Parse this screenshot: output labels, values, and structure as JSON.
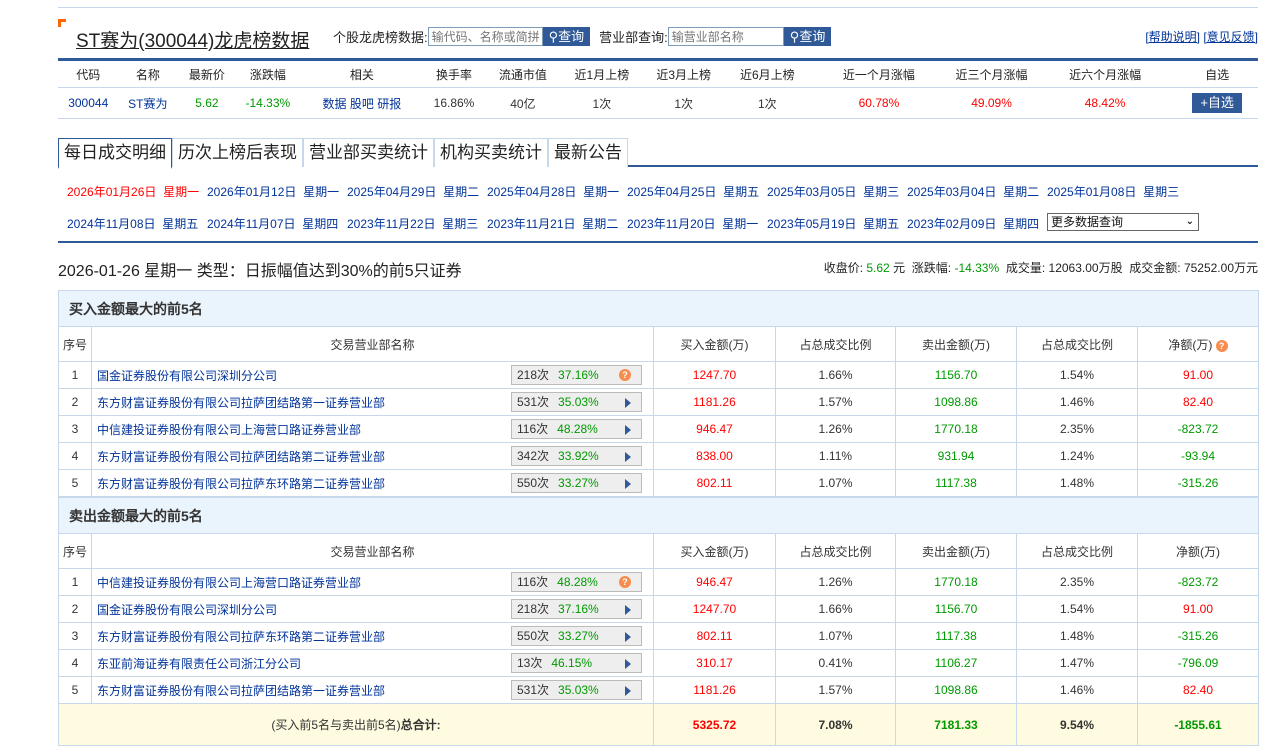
{
  "header": {
    "title": "ST赛为(300044)龙虎榜数据",
    "stock_search_label": "个股龙虎榜数据:",
    "stock_search_placeholder": "输代码、名称或简拼",
    "dept_search_label": "营业部查询:",
    "dept_search_placeholder": "输营业部名称",
    "query_label": "查询",
    "help": "[帮助说明]",
    "feedback": "[意见反馈]"
  },
  "stock": {
    "headers": [
      "代码",
      "名称",
      "最新价",
      "涨跌幅",
      "相关",
      "换手率",
      "流通市值",
      "近1月上榜",
      "近3月上榜",
      "近6月上榜",
      "近一个月涨幅",
      "近三个月涨幅",
      "近六个月涨幅",
      "自选"
    ],
    "code": "300044",
    "name": "ST赛为",
    "price": "5.62",
    "change": "-14.33%",
    "links": [
      "数据",
      "股吧",
      "研报"
    ],
    "turnover": "16.86%",
    "float_cap": "40亿",
    "m1": "1次",
    "m3": "1次",
    "m6": "1次",
    "r1": "60.78%",
    "r3": "49.09%",
    "r6": "48.42%",
    "add": "+自选"
  },
  "tabs": [
    "每日成交明细",
    "历次上榜后表现",
    "营业部买卖统计",
    "机构买卖统计",
    "最新公告"
  ],
  "dates": [
    [
      "2026年01月26日",
      "星期一"
    ],
    [
      "2026年01月12日",
      "星期一"
    ],
    [
      "2025年04月29日",
      "星期二"
    ],
    [
      "2025年04月28日",
      "星期一"
    ],
    [
      "2025年04月25日",
      "星期五"
    ],
    [
      "2025年03月05日",
      "星期三"
    ],
    [
      "2025年03月04日",
      "星期二"
    ],
    [
      "2025年01月08日",
      "星期三"
    ],
    [
      "2024年11月08日",
      "星期五"
    ],
    [
      "2024年11月07日",
      "星期四"
    ],
    [
      "2023年11月22日",
      "星期三"
    ],
    [
      "2023年11月21日",
      "星期二"
    ],
    [
      "2023年11月20日",
      "星期一"
    ],
    [
      "2023年05月19日",
      "星期五"
    ],
    [
      "2023年02月09日",
      "星期四"
    ]
  ],
  "more_select": "更多数据查询",
  "day": {
    "title": "2026-01-26 星期一 类型：日振幅值达到30%的前5只证券",
    "close_label": "收盘价:",
    "close": "5.62",
    "close_unit": "元",
    "chg_label": "涨跌幅:",
    "chg": "-14.33%",
    "vol_label": "成交量:",
    "vol": "12063.00万股",
    "amt_label": "成交金额:",
    "amt": "75252.00万元"
  },
  "columns": [
    "序号",
    "交易营业部名称",
    "买入金额(万)",
    "占总成交比例",
    "卖出金额(万)",
    "占总成交比例",
    "净额(万)"
  ],
  "buy": {
    "title": "买入金额最大的前5名",
    "rows": [
      [
        "1",
        "国金证券股份有限公司深圳分公司",
        "218次",
        "37.16%",
        "1247.70",
        "1.66%",
        "1156.70",
        "1.54%",
        "91.00"
      ],
      [
        "2",
        "东方财富证券股份有限公司拉萨团结路第一证券营业部",
        "531次",
        "35.03%",
        "1181.26",
        "1.57%",
        "1098.86",
        "1.46%",
        "82.40"
      ],
      [
        "3",
        "中信建投证券股份有限公司上海营口路证券营业部",
        "116次",
        "48.28%",
        "946.47",
        "1.26%",
        "1770.18",
        "2.35%",
        "-823.72"
      ],
      [
        "4",
        "东方财富证券股份有限公司拉萨团结路第二证券营业部",
        "342次",
        "33.92%",
        "838.00",
        "1.11%",
        "931.94",
        "1.24%",
        "-93.94"
      ],
      [
        "5",
        "东方财富证券股份有限公司拉萨东环路第二证券营业部",
        "550次",
        "33.27%",
        "802.11",
        "1.07%",
        "1117.38",
        "1.48%",
        "-315.26"
      ]
    ]
  },
  "sell": {
    "title": "卖出金额最大的前5名",
    "rows": [
      [
        "1",
        "中信建投证券股份有限公司上海营口路证券营业部",
        "116次",
        "48.28%",
        "946.47",
        "1.26%",
        "1770.18",
        "2.35%",
        "-823.72"
      ],
      [
        "2",
        "国金证券股份有限公司深圳分公司",
        "218次",
        "37.16%",
        "1247.70",
        "1.66%",
        "1156.70",
        "1.54%",
        "91.00"
      ],
      [
        "3",
        "东方财富证券股份有限公司拉萨东环路第二证券营业部",
        "550次",
        "33.27%",
        "802.11",
        "1.07%",
        "1117.38",
        "1.48%",
        "-315.26"
      ],
      [
        "4",
        "东亚前海证券有限责任公司浙江分公司",
        "13次",
        "46.15%",
        "310.17",
        "0.41%",
        "1106.27",
        "1.47%",
        "-796.09"
      ],
      [
        "5",
        "东方财富证券股份有限公司拉萨团结路第一证券营业部",
        "531次",
        "35.03%",
        "1181.26",
        "1.57%",
        "1098.86",
        "1.46%",
        "82.40"
      ]
    ]
  },
  "total": {
    "label_prefix": "(买入前5名与卖出前5名)",
    "label_bold": "总合计:",
    "buy": "5325.72",
    "buy_pct": "7.08%",
    "sell": "7181.33",
    "sell_pct": "9.54%",
    "net": "-1855.61"
  },
  "colors": {
    "accent": "#2f5997",
    "up": "#ff0000",
    "down": "#009900",
    "link": "#003399"
  }
}
